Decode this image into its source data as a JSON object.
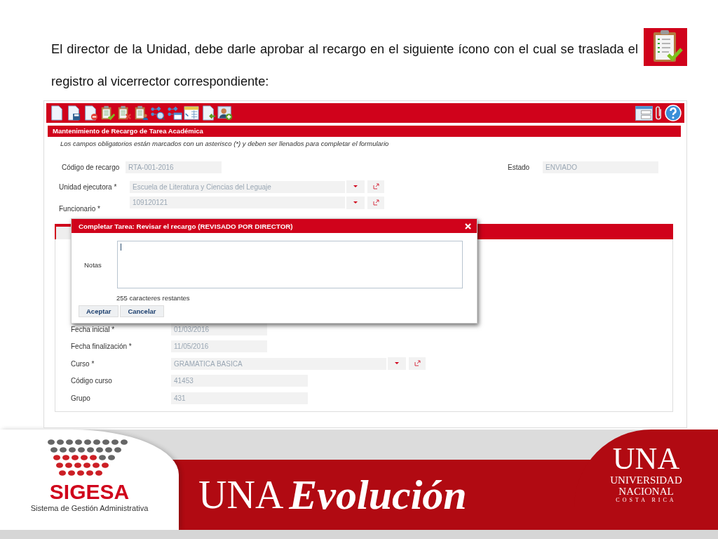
{
  "slide": {
    "text": "El director de la Unidad, debe darle aprobar al recargo en el siguiente ícono con el cual se traslada el registro al vicerrector correspondiente:"
  },
  "form": {
    "title": "Mantenimiento de Recargo de Tarea Académica",
    "note": "Los campos obligatorios están marcados con un asterisco (*) y deben ser llenados para completar el formulario",
    "codigo": {
      "label": "Código de recargo",
      "value": "RTA-001-2016"
    },
    "estado": {
      "label": "Estado",
      "value": "ENVIADO"
    },
    "unidad": {
      "label": "Unidad ejecutora *",
      "value": "Escuela de Literatura y Ciencias del Leguaje"
    },
    "funcionario": {
      "label": "Funcionario *",
      "value": "109120121"
    },
    "tab_fields": [
      {
        "kind": "date",
        "label": "Fecha inicial *",
        "value": "01/03/2016"
      },
      {
        "kind": "date",
        "label": "Fecha finalización *",
        "value": "11/05/2016"
      },
      {
        "kind": "select",
        "label": "Curso *",
        "value": "GRAMATICA BASICA"
      },
      {
        "kind": "text",
        "label": "Código curso",
        "value": "41453"
      },
      {
        "kind": "text",
        "label": "Grupo",
        "value": "431"
      }
    ]
  },
  "dialog": {
    "title": "Completar Tarea: Revisar el recargo (REVISADO POR DIRECTOR)",
    "notes_label": "Notas",
    "notes_focused": true,
    "counter": "255 caracteres restantes",
    "buttons": [
      "Aceptar",
      "Cancelar"
    ]
  },
  "footer": {
    "logo_text": "SIGESA",
    "logo_subtitle": "Sistema de Gestión Administrativa",
    "brand": "UNA",
    "slogan": "Evolución",
    "university": {
      "acronym": "UNA",
      "name_lines": [
        "UNIVERSIDAD",
        "NACIONAL"
      ],
      "country": "COSTA RICA"
    }
  }
}
